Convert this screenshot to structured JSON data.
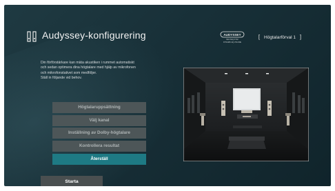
{
  "header": {
    "title": "Audyssey-konfigurering",
    "brand_logo_text": "AUDYSSEY MULTEQ XT32 DYNAMIC EQ VOLUME",
    "preset_bracket_left": "[",
    "preset_label": "Högtalarförval 1",
    "preset_bracket_right": "]"
  },
  "description": {
    "line1": "Din förförstärkare kan mäta akustiken i rummet automatiskt",
    "line2": "och sedan optimera dina högtalare med hjälp av mikrofonen",
    "line3": "och mikrofonstativet som medföljer.",
    "line4": "Ställ in följande vid behov."
  },
  "menu": {
    "items": [
      {
        "label": "Högtalaruppsättning"
      },
      {
        "label": "Välj kanal"
      },
      {
        "label": "Inställning av Dolby-högtalare"
      },
      {
        "label": "Kontrollera resultat"
      },
      {
        "label": "Återställ"
      }
    ],
    "selected": "Återställ"
  },
  "start_button": {
    "label": "Starta"
  },
  "colors": {
    "background": "#183038",
    "menu_item": "#4d5658",
    "menu_selected": "#1e7a84",
    "start_button": "#4a4f50"
  },
  "icons": {
    "header": "speaker-pair-icon",
    "illustration": "home-theater-room-illustration"
  }
}
